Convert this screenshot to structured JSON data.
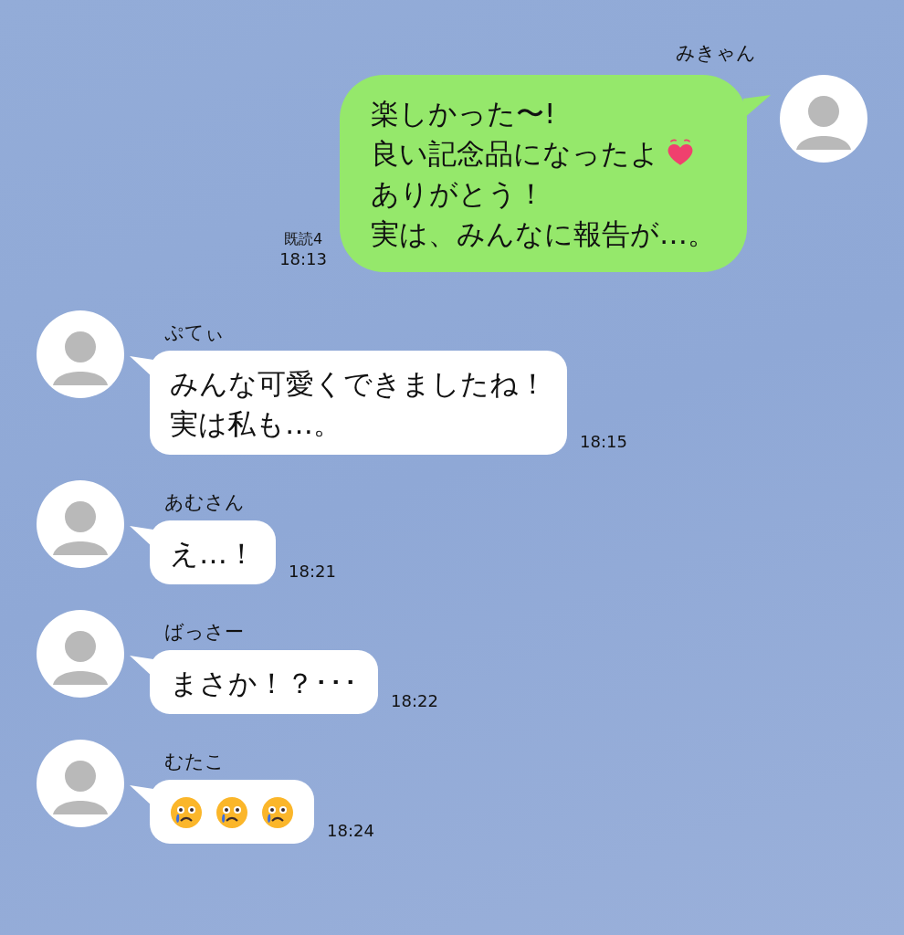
{
  "messages": [
    {
      "kind": "outgoing",
      "sender": "みきゃん",
      "lines": [
        {
          "text": "楽しかった〜!",
          "kind": "plain"
        },
        {
          "text": "良い記念品になったよ",
          "kind": "heart"
        },
        {
          "text": "ありがとう！",
          "kind": "plain"
        },
        {
          "text": "実は、みんなに報告が…。",
          "kind": "plain"
        }
      ],
      "read": "既読4",
      "time": "18:13"
    },
    {
      "kind": "incoming",
      "sender": "ぷてぃ",
      "lines": [
        {
          "text": "みんな可愛くできましたね！",
          "kind": "plain"
        },
        {
          "text": "実は私も…。",
          "kind": "plain"
        }
      ],
      "time": "18:15"
    },
    {
      "kind": "incoming",
      "sender": "あむさん",
      "lines": [
        {
          "text": "え…！",
          "kind": "plain"
        }
      ],
      "time": "18:21"
    },
    {
      "kind": "incoming",
      "sender": "ばっさー",
      "lines": [
        {
          "text": "まさか！？･･･",
          "kind": "plain"
        }
      ],
      "time": "18:22"
    },
    {
      "kind": "incoming",
      "sender": "むたこ",
      "emojis": [
        {
          "kind": "crying"
        },
        {
          "kind": "crying"
        },
        {
          "kind": "crying"
        }
      ],
      "time": "18:24"
    }
  ]
}
